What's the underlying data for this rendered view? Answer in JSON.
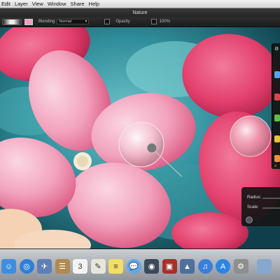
{
  "menubar": {
    "items": [
      "Edit",
      "Layer",
      "View",
      "Window",
      "Share",
      "Help"
    ]
  },
  "window": {
    "title": "Nature"
  },
  "toolbar": {
    "swatch_color": "#f59cc2",
    "blending_label": "Blending",
    "blending_value": "Normal",
    "opacity_label": "Opacity",
    "opacity_value": "100%"
  },
  "hud": {
    "radius_label": "Radius:",
    "scale_label": "Scale:"
  },
  "tools": [
    {
      "name": "blue-tool",
      "color": "#5aa3e6"
    },
    {
      "name": "red-tool",
      "color": "#d94848"
    },
    {
      "name": "green-tool",
      "color": "#5cbf4a"
    },
    {
      "name": "yellow-tool",
      "color": "#e7c43b"
    },
    {
      "name": "orange-tool",
      "color": "#e8943a"
    }
  ],
  "dock": {
    "apps": [
      {
        "name": "finder-icon",
        "color": "#3e8ee0",
        "glyph": "☺"
      },
      {
        "name": "safari-icon",
        "color": "#2f7fd6",
        "glyph": "◎"
      },
      {
        "name": "mail-icon",
        "color": "#5f7fb6",
        "glyph": "✈"
      },
      {
        "name": "contacts-icon",
        "color": "#b08a52",
        "glyph": "☰"
      },
      {
        "name": "calendar-icon",
        "color": "#f3f3f3",
        "glyph": "3"
      },
      {
        "name": "textedit-icon",
        "color": "#e8e6da",
        "glyph": "✎"
      },
      {
        "name": "notes-icon",
        "color": "#f2df63",
        "glyph": "≡"
      },
      {
        "name": "messages-icon",
        "color": "#5ea8f0",
        "glyph": "💬"
      },
      {
        "name": "facetime-icon",
        "color": "#3a4a5a",
        "glyph": "◉"
      },
      {
        "name": "photo-booth-icon",
        "color": "#a5312b",
        "glyph": "▣"
      },
      {
        "name": "iphoto-icon",
        "color": "#4f6f9f",
        "glyph": "▲"
      },
      {
        "name": "itunes-icon",
        "color": "#3b7fd9",
        "glyph": "♫"
      },
      {
        "name": "app-store-icon",
        "color": "#2b86e3",
        "glyph": "A"
      },
      {
        "name": "preferences-icon",
        "color": "#8f8f8f",
        "glyph": "⚙"
      },
      {
        "name": "folder-icon",
        "color": "#86a8cf",
        "glyph": ""
      }
    ]
  }
}
